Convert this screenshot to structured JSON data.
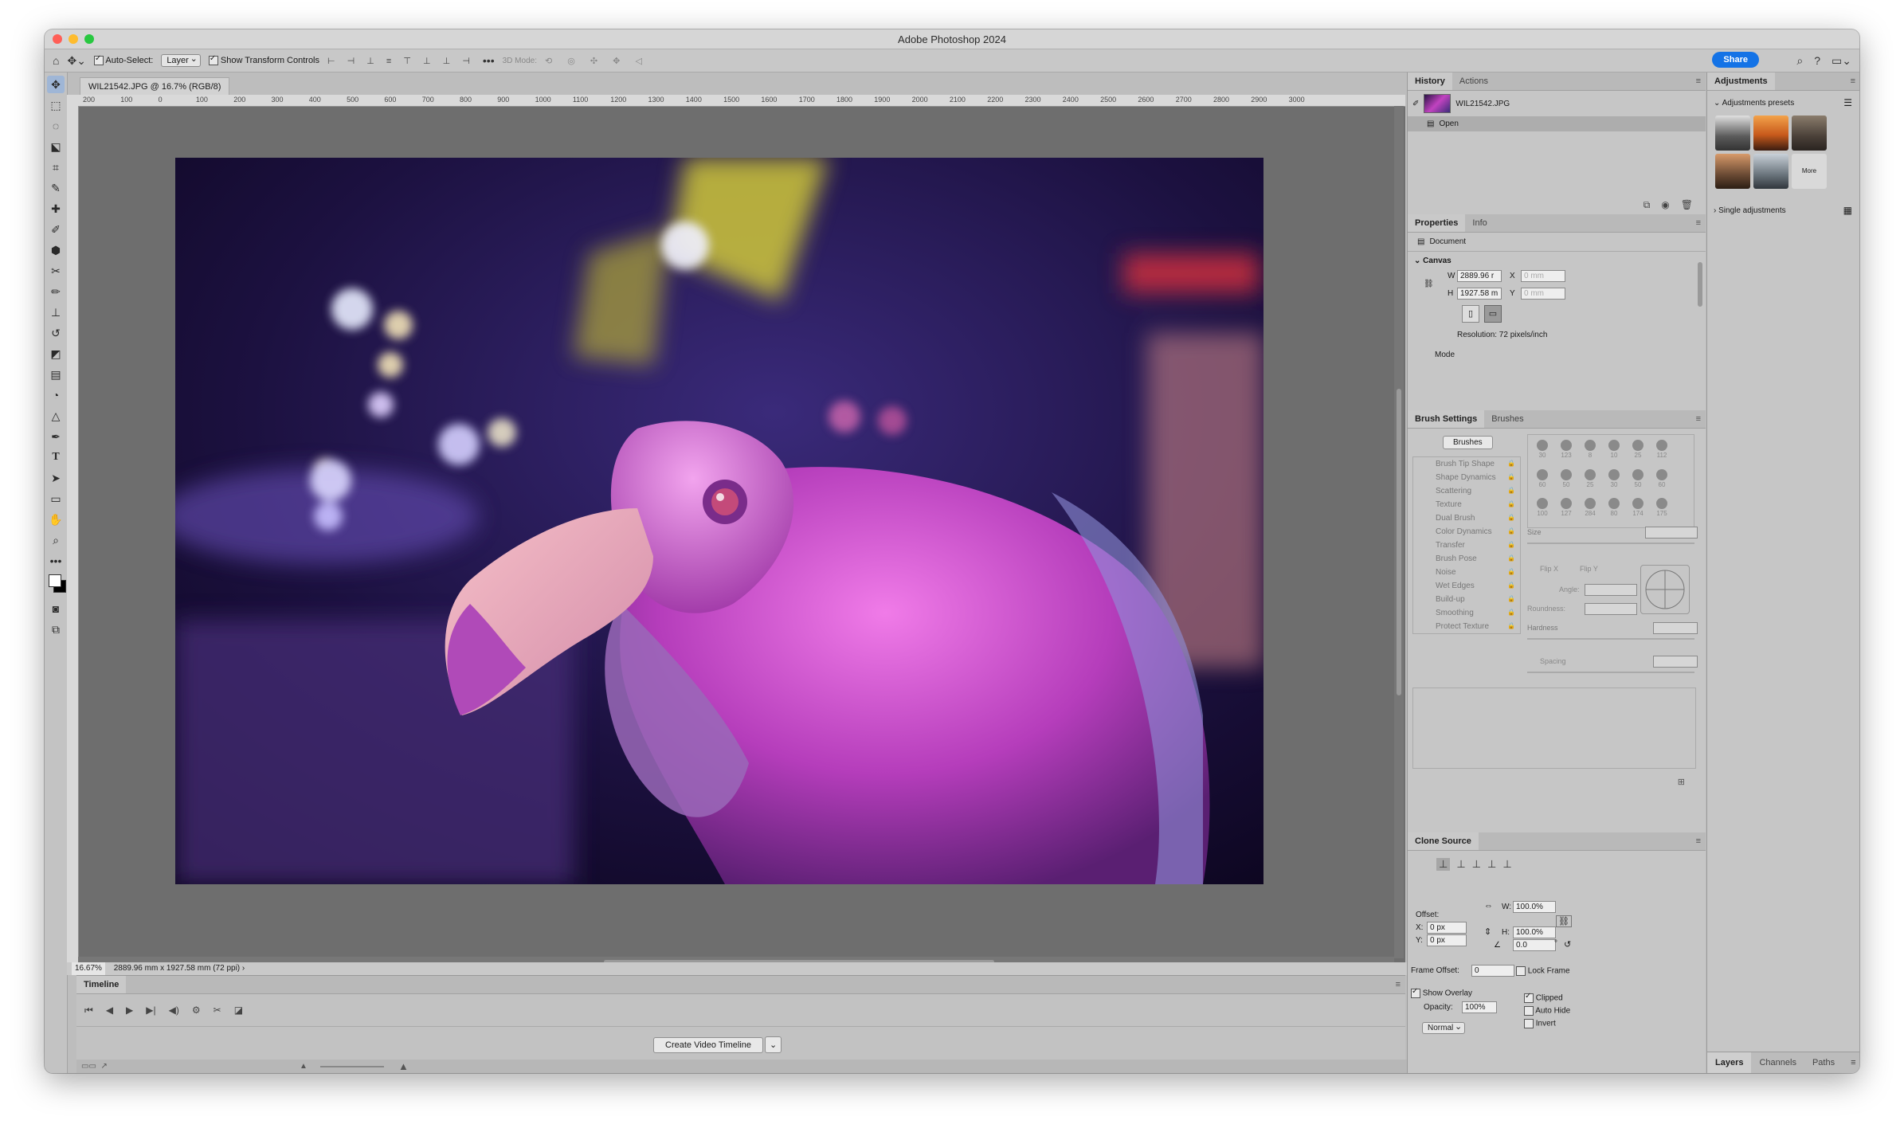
{
  "window": {
    "title": "Adobe Photoshop 2024"
  },
  "options_bar": {
    "auto_select_label": "Auto-Select:",
    "layer_select": "Layer",
    "transform_controls_label": "Show Transform Controls",
    "mode_3d_label": "3D Mode:",
    "share_label": "Share"
  },
  "document": {
    "tab_label": "WIL21542.JPG @ 16.7% (RGB/8)",
    "zoom": "16.67%",
    "status": "2889.96 mm x 1927.58 mm (72 ppi)",
    "ruler_ticks": [
      "200",
      "100",
      "0",
      "100",
      "200",
      "300",
      "400",
      "500",
      "600",
      "700",
      "800",
      "900",
      "1000",
      "1100",
      "1200",
      "1300",
      "1400",
      "1500",
      "1600",
      "1700",
      "1800",
      "1900",
      "2000",
      "2100",
      "2200",
      "2300",
      "2400",
      "2500",
      "2600",
      "2700",
      "2800",
      "2900",
      "3000"
    ]
  },
  "timeline": {
    "title": "Timeline",
    "create_button": "Create Video Timeline"
  },
  "history": {
    "tabs": [
      "History",
      "Actions"
    ],
    "snapshot_name": "WIL21542.JPG",
    "items": [
      "Open"
    ]
  },
  "properties": {
    "tabs": [
      "Properties",
      "Info"
    ],
    "document_label": "Document",
    "canvas_label": "Canvas",
    "w_label": "W",
    "w_value": "2889.96 r",
    "h_label": "H",
    "h_value": "1927.58 m",
    "x_label": "X",
    "x_placeholder": "0 mm",
    "y_label": "Y",
    "y_placeholder": "0 mm",
    "resolution": "Resolution: 72 pixels/inch",
    "mode_label": "Mode"
  },
  "brush_settings": {
    "tabs": [
      "Brush Settings",
      "Brushes"
    ],
    "brushes_button": "Brushes",
    "items": [
      "Brush Tip Shape",
      "Shape Dynamics",
      "Scattering",
      "Texture",
      "Dual Brush",
      "Color Dynamics",
      "Transfer",
      "Brush Pose",
      "Noise",
      "Wet Edges",
      "Build-up",
      "Smoothing",
      "Protect Texture"
    ],
    "tip_sizes": [
      "30",
      "123",
      "8",
      "10",
      "25",
      "112",
      "60",
      "50",
      "25",
      "30",
      "50",
      "60",
      "100",
      "127",
      "284",
      "80",
      "174",
      "175"
    ],
    "size_label": "Size",
    "flip_x": "Flip X",
    "flip_y": "Flip Y",
    "angle_label": "Angle:",
    "roundness_label": "Roundness:",
    "hardness_label": "Hardness",
    "spacing_label": "Spacing"
  },
  "clone_source": {
    "title": "Clone Source",
    "offset_label": "Offset:",
    "x_label": "X:",
    "x_value": "0 px",
    "y_label": "Y:",
    "y_value": "0 px",
    "w_label": "W:",
    "w_value": "100.0%",
    "h_label": "H:",
    "h_value": "100.0%",
    "angle_value": "0.0",
    "angle_unit": "°",
    "frame_offset_label": "Frame Offset:",
    "frame_offset_value": "0",
    "lock_frame_label": "Lock Frame",
    "show_overlay_label": "Show Overlay",
    "opacity_label": "Opacity:",
    "opacity_value": "100%",
    "blend_mode": "Normal",
    "clipped_label": "Clipped",
    "auto_hide_label": "Auto Hide",
    "invert_label": "Invert"
  },
  "adjustments": {
    "title": "Adjustments",
    "presets_label": "Adjustments presets",
    "more_label": "More",
    "single_label": "Single adjustments"
  },
  "bottom_tabs": [
    "Layers",
    "Channels",
    "Paths"
  ],
  "colors": {
    "accent": "#1473e6",
    "close": "#ff5f57",
    "minimize": "#febc2e",
    "zoom": "#28c840"
  }
}
